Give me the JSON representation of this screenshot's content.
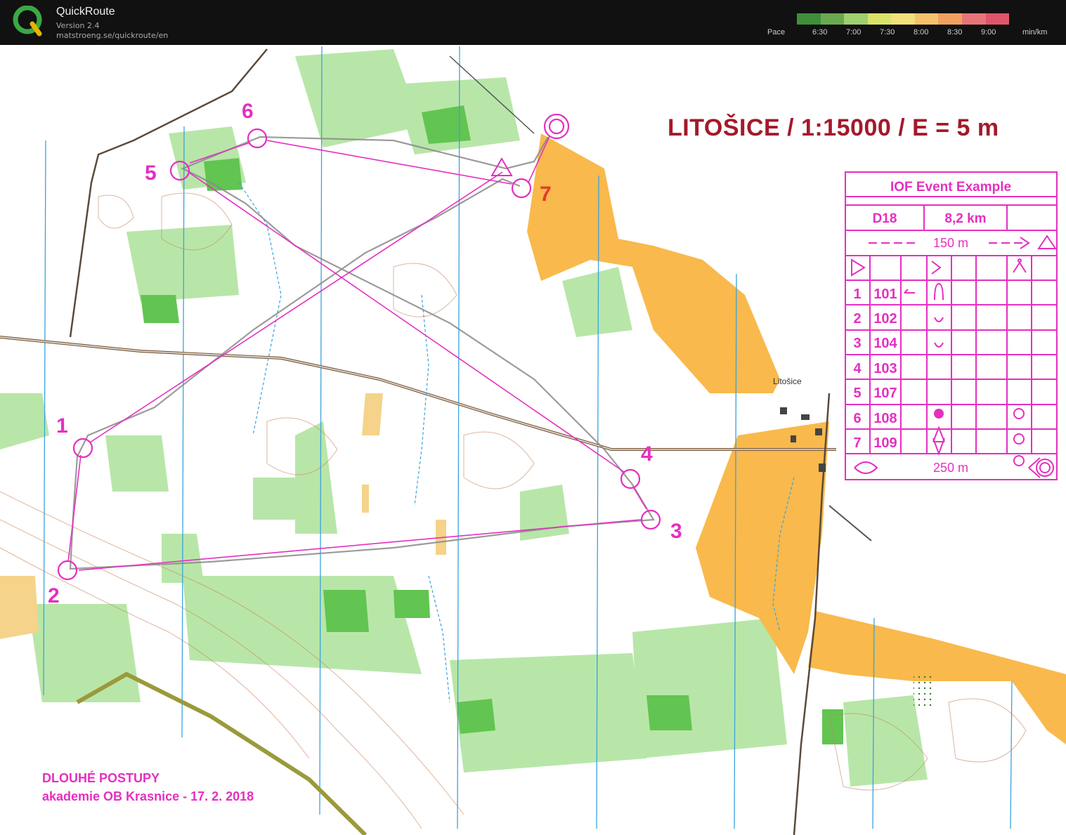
{
  "app": {
    "title": "QuickRoute",
    "version": "Version 2.4",
    "url": "matstroeng.se/quickroute/en"
  },
  "pace": {
    "label": "Pace",
    "ticks": [
      "6:30",
      "7:00",
      "7:30",
      "8:00",
      "8:30",
      "9:00"
    ],
    "unit": "min/km",
    "colors": [
      "#3f8f3a",
      "#6aa84f",
      "#9fcf6f",
      "#d9e36a",
      "#f1e07a",
      "#f5c26b",
      "#f0a060",
      "#e6757a",
      "#e0556a"
    ]
  },
  "map": {
    "title": "LITOŠICE / 1:15000 / E = 5 m",
    "village": "Litošice",
    "footer_line1": "DLOUHÉ POSTUPY",
    "footer_line2": "akademie OB Krasnice - 17. 2. 2018",
    "course_color": "#e52fc1",
    "route_color": "#8a8a8a",
    "controls": [
      {
        "label": "1"
      },
      {
        "label": "2"
      },
      {
        "label": "3"
      },
      {
        "label": "4"
      },
      {
        "label": "5"
      },
      {
        "label": "6"
      },
      {
        "label": "7"
      }
    ]
  },
  "control_description": {
    "event": "IOF Event Example",
    "class": "D18",
    "length": "8,2 km",
    "start_distance": "150 m",
    "finish_distance": "250 m",
    "rows": [
      {
        "n": "1",
        "code": "101"
      },
      {
        "n": "2",
        "code": "102"
      },
      {
        "n": "3",
        "code": "104"
      },
      {
        "n": "4",
        "code": "103"
      },
      {
        "n": "5",
        "code": "107"
      },
      {
        "n": "6",
        "code": "108"
      },
      {
        "n": "7",
        "code": "109"
      }
    ]
  }
}
